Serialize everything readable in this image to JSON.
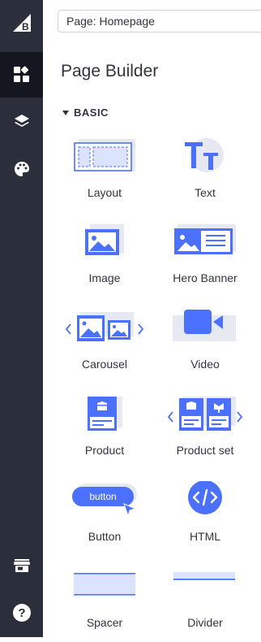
{
  "topbar": {
    "page_selector_value": "Page: Homepage"
  },
  "rail": {
    "items": [
      {
        "name": "logo",
        "icon": "bigcommerce-logo-icon"
      },
      {
        "name": "widgets",
        "icon": "widgets-grid-icon",
        "active": true
      },
      {
        "name": "layers",
        "icon": "layers-icon"
      },
      {
        "name": "theme-styles",
        "icon": "palette-icon"
      },
      {
        "name": "storefront",
        "icon": "store-icon"
      },
      {
        "name": "help",
        "icon": "help-circle-icon"
      }
    ]
  },
  "panel": {
    "title": "Page Builder",
    "section_label": "BASIC",
    "widgets": [
      {
        "label": "Layout",
        "icon": "layout-icon"
      },
      {
        "label": "Text",
        "icon": "text-icon"
      },
      {
        "label": "Image",
        "icon": "image-icon"
      },
      {
        "label": "Hero Banner",
        "icon": "hero-banner-icon"
      },
      {
        "label": "Carousel",
        "icon": "carousel-icon"
      },
      {
        "label": "Video",
        "icon": "video-icon"
      },
      {
        "label": "Product",
        "icon": "product-icon"
      },
      {
        "label": "Product set",
        "icon": "product-set-icon"
      },
      {
        "label": "Button",
        "icon": "button-icon",
        "preview_text": "button"
      },
      {
        "label": "HTML",
        "icon": "html-icon"
      },
      {
        "label": "Spacer",
        "icon": "spacer-icon"
      },
      {
        "label": "Divider",
        "icon": "divider-icon"
      }
    ]
  },
  "colors": {
    "rail_bg": "#2b2f3b",
    "rail_active": "#14171f",
    "accent": "#4b71fc",
    "accent_light": "#dbe3fe",
    "tile_bg": "#e6e9f2",
    "text": "#313440"
  }
}
